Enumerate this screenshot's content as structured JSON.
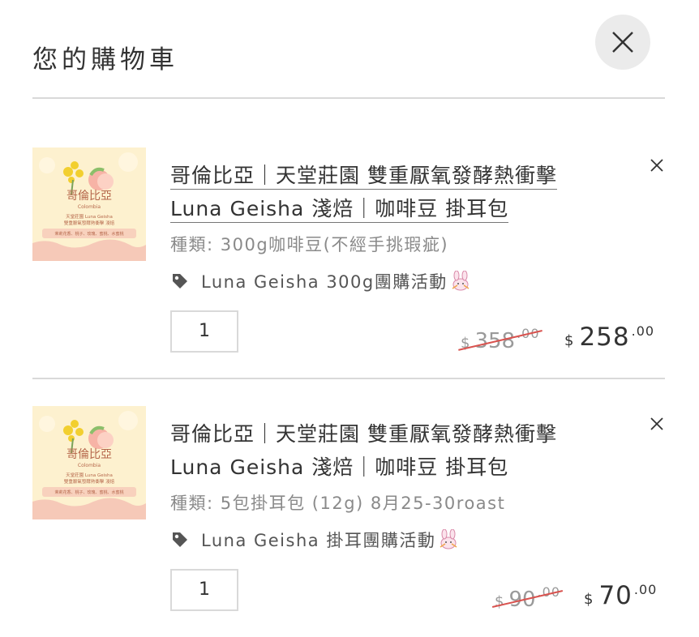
{
  "header": {
    "title": "您的購物車",
    "close_icon": "close-icon"
  },
  "items": [
    {
      "name_line1": "哥倫比亞｜天堂莊園 雙重厭氧發酵熱衝擊",
      "name_line2": "Luna Geisha 淺焙｜咖啡豆 掛耳包",
      "thumb_title": "哥倫比亞",
      "thumb_sub": "Colombia",
      "thumb_desc1": "天堂莊園 Luna Geisha",
      "thumb_desc2": "雙重厭氧發酵熱衝擊 淺焙",
      "thumb_note": "茉莉花香、桃子、玫瑰、蜜桃、水蜜桃",
      "variant": "種類: 300g咖啡豆(不經手挑瑕疵)",
      "promo": "Luna Geisha 300g團購活動",
      "quantity": "1",
      "old_price": {
        "currency": "$",
        "amount": "358",
        "decimals": ".00"
      },
      "new_price": {
        "currency": "$",
        "amount": "258",
        "decimals": ".00"
      }
    },
    {
      "name_line1": "哥倫比亞｜天堂莊園 雙重厭氧發酵熱衝擊",
      "name_line2": "Luna Geisha 淺焙｜咖啡豆 掛耳包",
      "thumb_title": "哥倫比亞",
      "thumb_sub": "Colombia",
      "thumb_desc1": "天堂莊園 Luna Geisha",
      "thumb_desc2": "雙重厭氧發酵熱衝擊 淺焙",
      "thumb_note": "茉莉花香、桃子、玫瑰、蜜桃、水蜜桃",
      "variant": "種類: 5包掛耳包 (12g) 8月25-30roast",
      "promo": "Luna Geisha 掛耳團購活動",
      "quantity": "1",
      "old_price": {
        "currency": "$",
        "amount": "90",
        "decimals": ".00"
      },
      "new_price": {
        "currency": "$",
        "amount": "70",
        "decimals": ".00"
      }
    }
  ],
  "colors": {
    "strike": "#d9534f",
    "divider": "#d9d9d9",
    "close_bg": "#ebebeb",
    "thumb_bg": "#fdf1cf",
    "thumb_wave": "#f6c9b8"
  },
  "icons": [
    "close-icon",
    "remove-x-icon",
    "tag-icon",
    "bunny-icon"
  ]
}
